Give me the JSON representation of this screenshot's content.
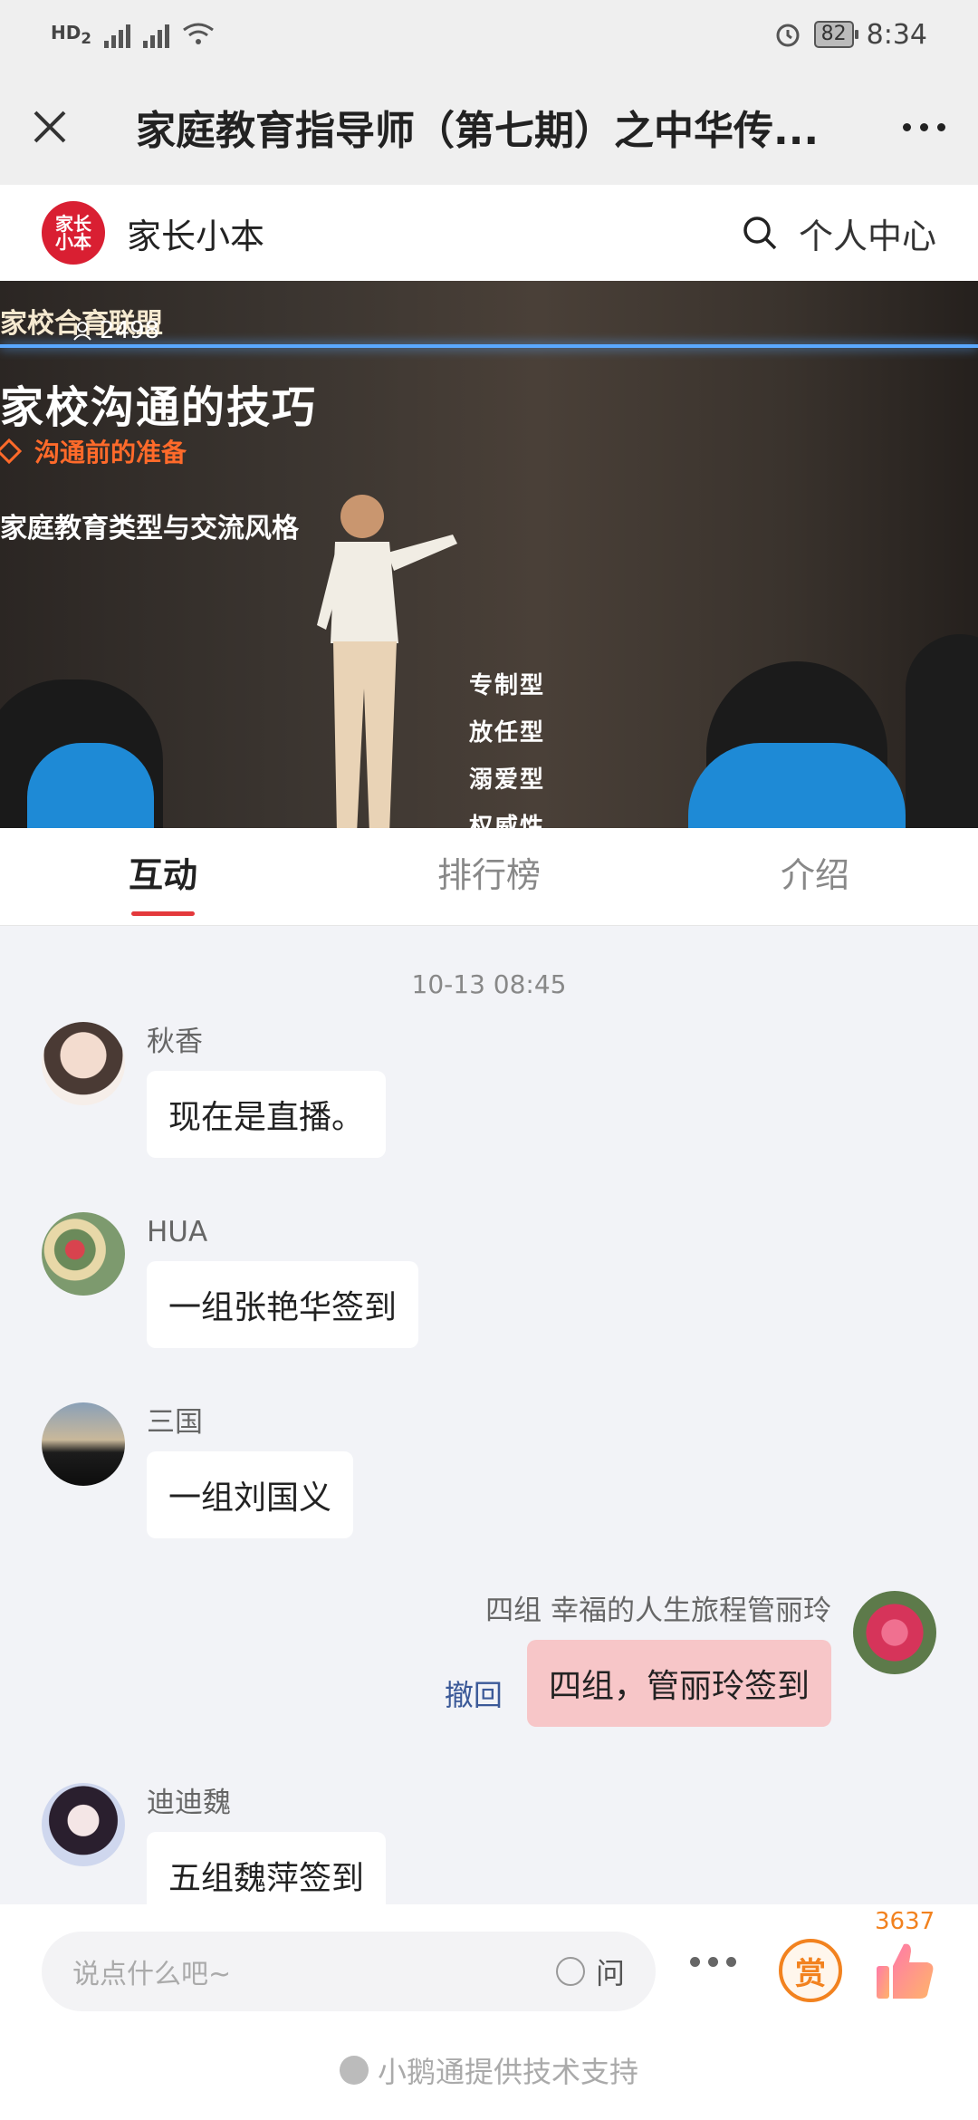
{
  "status_bar": {
    "left_icons": [
      "HD2",
      "2G",
      "4G",
      "wifi-icon"
    ],
    "battery": "82",
    "time": "8:34"
  },
  "title_bar": {
    "title": "家庭教育指导师（第七期）之中华传..."
  },
  "brand": {
    "logo_text": "家长小本",
    "name": "家长小本",
    "personal_center": "个人中心"
  },
  "video": {
    "watermark": "家校合育联盟",
    "viewers": "2498",
    "slide_title": "家校沟通的技巧",
    "slide_sub": "沟通前的准备",
    "slide_line3": "家庭教育类型与交流风格",
    "types": [
      "专制型",
      "放任型",
      "溺爱型",
      "权威性"
    ]
  },
  "tabs": [
    {
      "label": "互动",
      "active": true
    },
    {
      "label": "排行榜",
      "active": false
    },
    {
      "label": "介绍",
      "active": false
    }
  ],
  "chat": {
    "timestamp": "10-13 08:45",
    "messages": [
      {
        "nick": "秋香",
        "text": "现在是直播。"
      },
      {
        "nick": "HUA",
        "text": "一组张艳华签到"
      },
      {
        "nick": "三国",
        "text": "一组刘国义"
      },
      {
        "nick": "四组 幸福的人生旅程管丽玲",
        "text": "四组，管丽玲签到",
        "self": true,
        "recall": "撤回"
      },
      {
        "nick": "迪迪魏",
        "text": "五组魏萍签到"
      }
    ]
  },
  "bottom": {
    "input_placeholder": "说点什么吧~",
    "ask_label": "问",
    "reward_label": "赏",
    "like_count": "3637",
    "support_text": "小鹅通提供技术支持"
  },
  "colors": {
    "accent_red": "#e4393c",
    "brand_red": "#d91f32",
    "self_bubble": "#f7c6c8",
    "reward_orange": "#f2821f"
  }
}
